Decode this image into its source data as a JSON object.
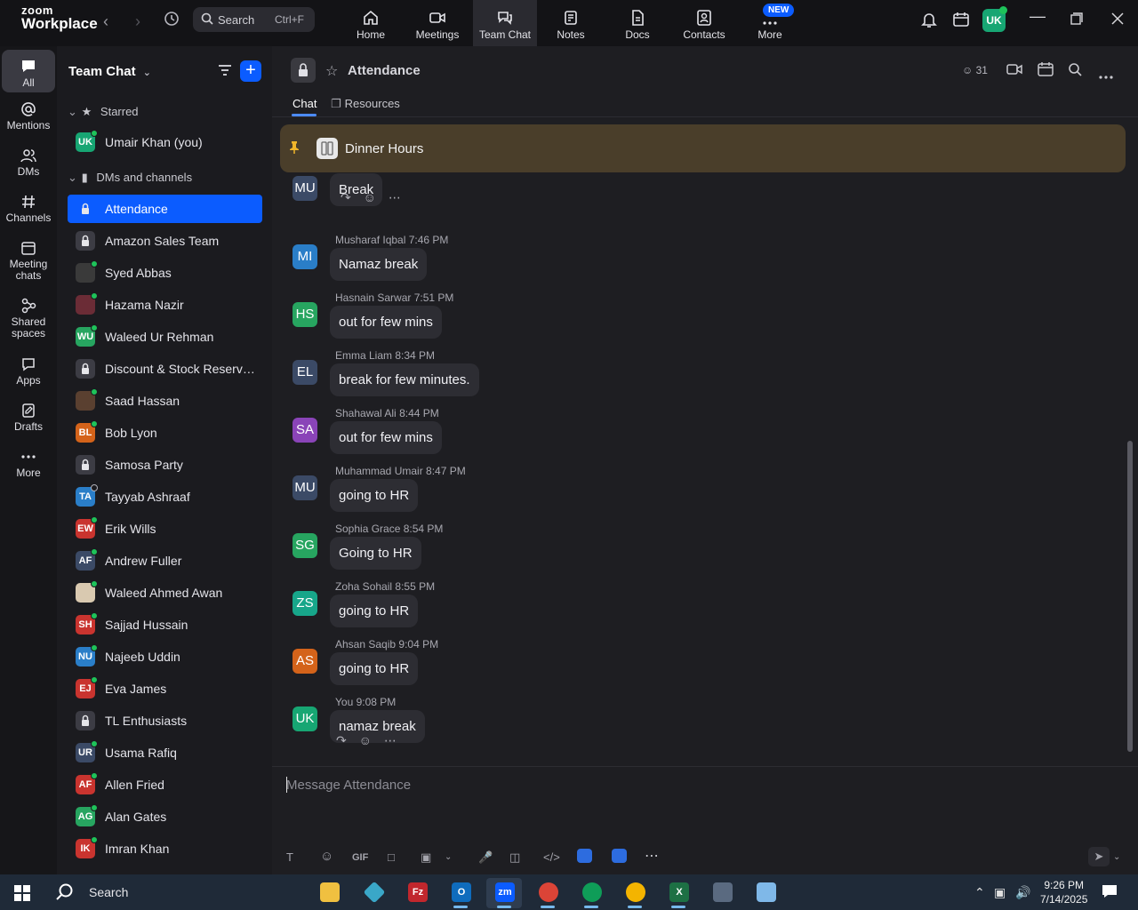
{
  "app": {
    "logo_line1": "zoom",
    "logo_line2": "Workplace"
  },
  "topbar": {
    "search_label": "Search",
    "search_shortcut": "Ctrl+F",
    "tabs": [
      {
        "label": "Home",
        "icon": "home-icon"
      },
      {
        "label": "Meetings",
        "icon": "video-icon"
      },
      {
        "label": "Team Chat",
        "icon": "chat-icon"
      },
      {
        "label": "Notes",
        "icon": "notes-icon"
      },
      {
        "label": "Docs",
        "icon": "docs-icon"
      },
      {
        "label": "Contacts",
        "icon": "contacts-icon"
      },
      {
        "label": "More",
        "icon": "more-icon"
      }
    ],
    "active_tab": "Team Chat",
    "new_badge": "NEW",
    "user_initials": "UK"
  },
  "rail": {
    "items": [
      {
        "label": "All",
        "icon": "chat-bubble-icon"
      },
      {
        "label": "Mentions",
        "icon": "at-icon"
      },
      {
        "label": "DMs",
        "icon": "people-icon"
      },
      {
        "label": "Channels",
        "icon": "hash-icon"
      },
      {
        "label_line1": "Meeting",
        "label_line2": "chats",
        "icon": "calendar-icon"
      },
      {
        "label_line1": "Shared",
        "label_line2": "spaces",
        "icon": "shared-icon"
      },
      {
        "label": "Apps",
        "icon": "apps-icon"
      },
      {
        "label": "Drafts",
        "icon": "drafts-icon"
      },
      {
        "label": "More",
        "icon": "ellipsis-icon"
      }
    ]
  },
  "sidebar": {
    "title": "Team Chat",
    "starred_label": "Starred",
    "starred": [
      {
        "name": "Umair Khan (you)",
        "initials": "UK",
        "color": "#17a673",
        "online": true
      }
    ],
    "dms_label": "DMs and channels",
    "items": [
      {
        "name": "Attendance",
        "type": "lock",
        "active": true
      },
      {
        "name": "Amazon Sales Team",
        "type": "lock"
      },
      {
        "name": "Syed Abbas",
        "initials": "",
        "color": "#3a3a3a",
        "online": true
      },
      {
        "name": "Hazama Nazir",
        "initials": "",
        "color": "#6b2c36",
        "online": true
      },
      {
        "name": "Waleed Ur Rehman",
        "initials": "WU",
        "color": "#27a560",
        "online": true
      },
      {
        "name": "Discount & Stock Reservati...",
        "type": "lock"
      },
      {
        "name": "Saad Hassan",
        "initials": "",
        "color": "#5a4030",
        "online": true
      },
      {
        "name": "Bob Lyon",
        "initials": "BL",
        "color": "#d4631a",
        "online": true
      },
      {
        "name": "Samosa Party",
        "type": "lock"
      },
      {
        "name": "Tayyab Ashraaf",
        "initials": "TA",
        "color": "#2a7ec8",
        "online": false
      },
      {
        "name": "Erik Wills",
        "initials": "EW",
        "color": "#c9342f",
        "online": true
      },
      {
        "name": "Andrew Fuller",
        "initials": "AF",
        "color": "#3b4a66",
        "online": true
      },
      {
        "name": "Waleed Ahmed Awan",
        "initials": "",
        "color": "#d9c9b0",
        "online": true
      },
      {
        "name": "Sajjad Hussain",
        "initials": "SH",
        "color": "#c9342f",
        "online": true
      },
      {
        "name": "Najeeb Uddin",
        "initials": "NU",
        "color": "#2a7ec8",
        "online": true
      },
      {
        "name": "Eva James",
        "initials": "EJ",
        "color": "#c9342f",
        "online": true
      },
      {
        "name": "TL Enthusiasts",
        "type": "lock"
      },
      {
        "name": "Usama Rafiq",
        "initials": "UR",
        "color": "#3b4a66",
        "online": true
      },
      {
        "name": "Allen Fried",
        "initials": "AF",
        "color": "#c9342f",
        "online": true
      },
      {
        "name": "Alan Gates",
        "initials": "AG",
        "color": "#27a560",
        "online": true
      },
      {
        "name": "Imran Khan",
        "initials": "IK",
        "color": "#c9342f",
        "online": true
      }
    ]
  },
  "channel": {
    "title": "Attendance",
    "tab_chat": "Chat",
    "tab_resources": "Resources",
    "member_count": "31",
    "pinned_text": "Dinner Hours",
    "composer_placeholder": "Message Attendance"
  },
  "messages": [
    {
      "initials": "MU",
      "color": "#3b4a66",
      "author": "",
      "time": "",
      "text": "Break"
    },
    {
      "initials": "MI",
      "color": "#2a7ec8",
      "author": "Musharaf Iqbal",
      "time": "7:46 PM",
      "text": "Namaz break"
    },
    {
      "initials": "HS",
      "color": "#27a560",
      "author": "Hasnain Sarwar",
      "time": "7:51 PM",
      "text": "out for few mins"
    },
    {
      "initials": "EL",
      "color": "#3b4a66",
      "author": "Emma Liam",
      "time": "8:34 PM",
      "text": "break for few minutes."
    },
    {
      "initials": "SA",
      "color": "#8a44b8",
      "author": "Shahawal Ali",
      "time": "8:44 PM",
      "text": "out for few mins"
    },
    {
      "initials": "MU",
      "color": "#3b4a66",
      "author": "Muhammad Umair",
      "time": "8:47 PM",
      "text": "going to HR"
    },
    {
      "initials": "SG",
      "color": "#27a560",
      "author": "Sophia Grace",
      "time": "8:54 PM",
      "text": "Going to HR"
    },
    {
      "initials": "ZS",
      "color": "#17a68a",
      "author": "Zoha Sohail",
      "time": "8:55 PM",
      "text": "going to HR"
    },
    {
      "initials": "AS",
      "color": "#d4631a",
      "author": "Ahsan Saqib",
      "time": "9:04 PM",
      "text": "going to HR"
    },
    {
      "initials": "UK",
      "color": "#17a673",
      "author": "You",
      "time": "9:08 PM",
      "text": "namaz break"
    }
  ],
  "composer_tools": {
    "gif": "GIF"
  },
  "taskbar": {
    "search_label": "Search",
    "time": "9:26 PM",
    "date": "7/14/2025"
  }
}
